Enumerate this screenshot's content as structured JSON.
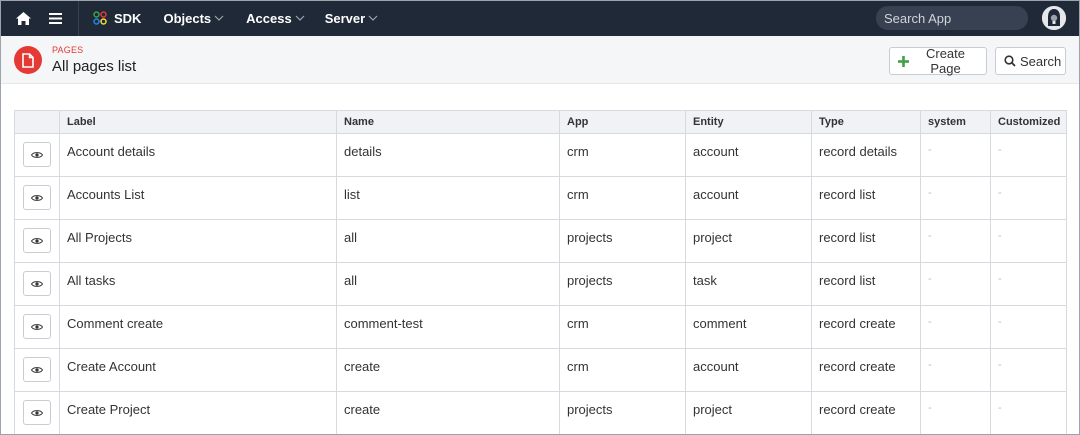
{
  "nav": {
    "brand": "SDK",
    "menus": [
      {
        "label": "Objects"
      },
      {
        "label": "Access"
      },
      {
        "label": "Server"
      }
    ],
    "search_placeholder": "Search App"
  },
  "header": {
    "kicker": "PAGES",
    "title": "All pages list",
    "create_label": "Create Page",
    "search_label": "Search"
  },
  "colors": {
    "navbar": "#1f2937",
    "accent_red": "#e53935",
    "create_plus": "#43a047"
  },
  "table": {
    "columns": [
      "",
      "Label",
      "Name",
      "App",
      "Entity",
      "Type",
      "system",
      "Customized"
    ],
    "rows": [
      {
        "label": "Account details",
        "name": "details",
        "app": "crm",
        "entity": "account",
        "type": "record details",
        "system": "-",
        "customized": "-"
      },
      {
        "label": "Accounts List",
        "name": "list",
        "app": "crm",
        "entity": "account",
        "type": "record list",
        "system": "-",
        "customized": "-"
      },
      {
        "label": "All Projects",
        "name": "all",
        "app": "projects",
        "entity": "project",
        "type": "record list",
        "system": "-",
        "customized": "-"
      },
      {
        "label": "All tasks",
        "name": "all",
        "app": "projects",
        "entity": "task",
        "type": "record list",
        "system": "-",
        "customized": "-"
      },
      {
        "label": "Comment create",
        "name": "comment-test",
        "app": "crm",
        "entity": "comment",
        "type": "record create",
        "system": "-",
        "customized": "-"
      },
      {
        "label": "Create Account",
        "name": "create",
        "app": "crm",
        "entity": "account",
        "type": "record create",
        "system": "-",
        "customized": "-"
      },
      {
        "label": "Create Project",
        "name": "create",
        "app": "projects",
        "entity": "project",
        "type": "record create",
        "system": "-",
        "customized": "-"
      }
    ]
  }
}
